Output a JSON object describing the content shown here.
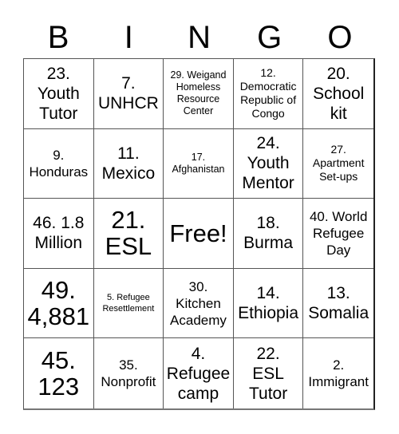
{
  "title_letters": [
    "B",
    "I",
    "N",
    "G",
    "O"
  ],
  "cells": [
    {
      "text": "23.\nYouth\nTutor",
      "size": "s-l"
    },
    {
      "text": "7.\nUNHCR",
      "size": "s-l"
    },
    {
      "text": "29. Weigand\nHomeless\nResource\nCenter",
      "size": "s-xs"
    },
    {
      "text": "12.\nDemocratic\nRepublic of\nCongo",
      "size": "s-s"
    },
    {
      "text": "20.\nSchool\nkit",
      "size": "s-l"
    },
    {
      "text": "9.\nHonduras",
      "size": "s-m"
    },
    {
      "text": "11.\nMexico",
      "size": "s-l"
    },
    {
      "text": "17.\nAfghanistan",
      "size": "s-xs"
    },
    {
      "text": "24.\nYouth\nMentor",
      "size": "s-l"
    },
    {
      "text": "27.\nApartment\nSet-ups",
      "size": "s-s"
    },
    {
      "text": "46. 1.8\nMillion",
      "size": "s-l"
    },
    {
      "text": "21.\nESL",
      "size": "s-xl"
    },
    {
      "text": "Free!",
      "size": "s-xl"
    },
    {
      "text": "18.\nBurma",
      "size": "s-l"
    },
    {
      "text": "40. World\nRefugee\nDay",
      "size": "s-m"
    },
    {
      "text": "49.\n4,881",
      "size": "s-xl"
    },
    {
      "text": "5. Refugee\nResettlement",
      "size": "s-xxs"
    },
    {
      "text": "30.\nKitchen\nAcademy",
      "size": "s-m"
    },
    {
      "text": "14.\nEthiopia",
      "size": "s-l"
    },
    {
      "text": "13.\nSomalia",
      "size": "s-l"
    },
    {
      "text": "45.\n123",
      "size": "s-xl"
    },
    {
      "text": "35.\nNonprofit",
      "size": "s-m"
    },
    {
      "text": "4.\nRefugee\ncamp",
      "size": "s-l"
    },
    {
      "text": "22.\nESL\nTutor",
      "size": "s-l"
    },
    {
      "text": "2.\nImmigrant",
      "size": "s-m"
    }
  ]
}
